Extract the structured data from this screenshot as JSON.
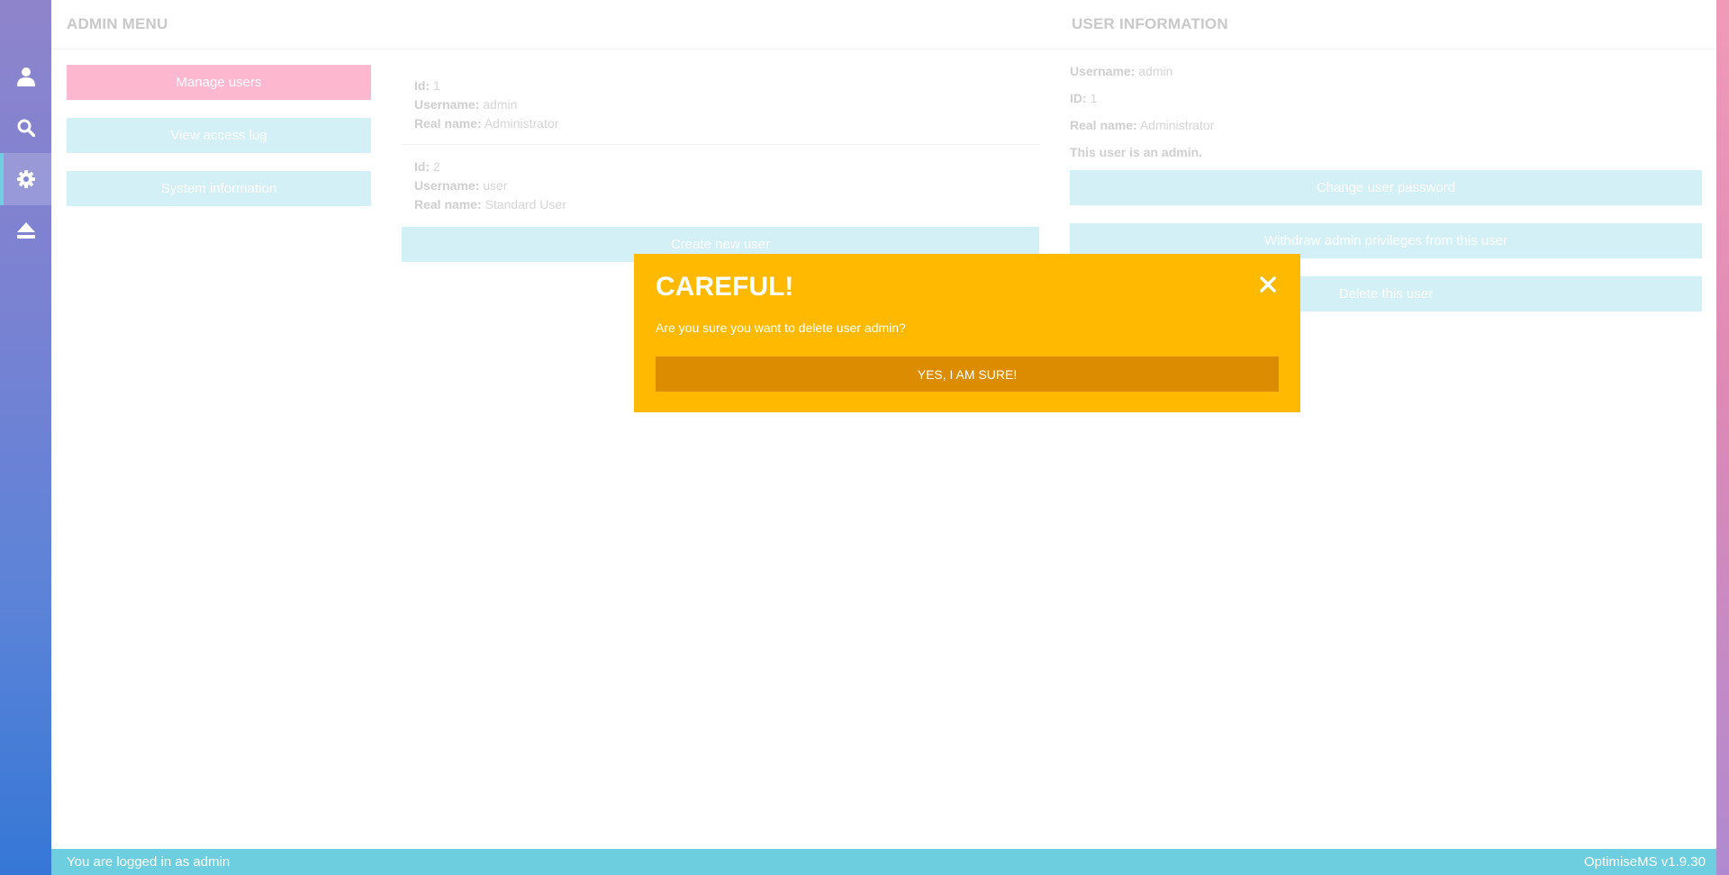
{
  "nav": {
    "items": [
      {
        "icon": "user-icon",
        "active": false
      },
      {
        "icon": "search-icon",
        "active": false
      },
      {
        "icon": "gear-icon",
        "active": true
      },
      {
        "icon": "eject-icon",
        "active": false
      }
    ]
  },
  "admin_menu": {
    "title": "ADMIN MENU",
    "buttons": [
      "Manage users",
      "View access log",
      "System information"
    ]
  },
  "user_list": {
    "users": [
      {
        "id_label": "Id:",
        "id": "1",
        "username_label": "Username:",
        "username": "admin",
        "realname_label": "Real name:",
        "realname": "Administrator"
      },
      {
        "id_label": "Id:",
        "id": "2",
        "username_label": "Username:",
        "username": "user",
        "realname_label": "Real name:",
        "realname": "Standard User"
      }
    ],
    "create_label": "Create new user"
  },
  "user_info": {
    "title": "USER INFORMATION",
    "username_label": "Username:",
    "username": "admin",
    "id_label": "ID:",
    "id": "1",
    "realname_label": "Real name:",
    "realname": "Administrator",
    "admin_note": "This user is an admin.",
    "buttons": [
      "Change user password",
      "Withdraw admin privileges from this user",
      "Delete this user"
    ]
  },
  "modal": {
    "title": "CAREFUL!",
    "message": "Are you sure you want to delete user admin?",
    "confirm_label": "YES, I AM SURE!"
  },
  "footer": {
    "status": "You are logged in as admin",
    "version": "OptimiseMS v1.9.30"
  },
  "colors": {
    "modal_bg": "#ffb900",
    "modal_button": "#db8c00",
    "footer_bg": "#6ccede",
    "active_button": "#fdb7cf",
    "inactive_button": "#d3f0f6"
  }
}
